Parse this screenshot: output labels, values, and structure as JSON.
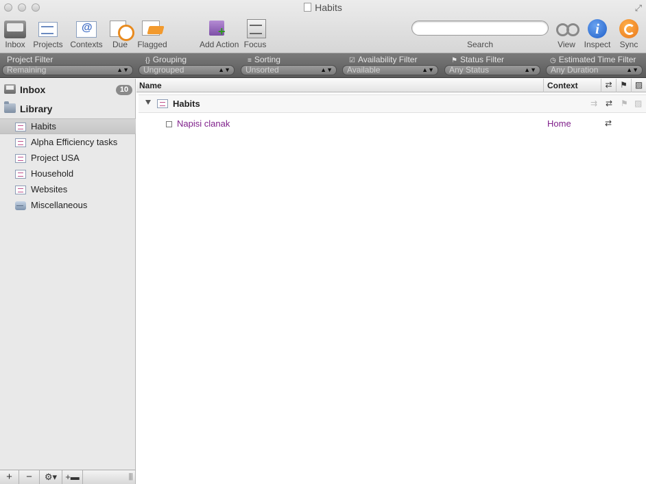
{
  "window": {
    "title": "Habits"
  },
  "toolbar": {
    "inbox": "Inbox",
    "projects": "Projects",
    "contexts": "Contexts",
    "due": "Due",
    "flagged": "Flagged",
    "add_action": "Add Action",
    "focus": "Focus",
    "search_label": "Search",
    "search_value": "",
    "view": "View",
    "inspect": "Inspect",
    "sync": "Sync"
  },
  "filters": {
    "project": {
      "title": "Project Filter",
      "value": "Remaining"
    },
    "grouping": {
      "title": "Grouping",
      "value": "Ungrouped"
    },
    "sorting": {
      "title": "Sorting",
      "value": "Unsorted"
    },
    "availability": {
      "title": "Availability Filter",
      "value": "Available"
    },
    "status": {
      "title": "Status Filter",
      "value": "Any Status"
    },
    "time": {
      "title": "Estimated Time Filter",
      "value": "Any Duration"
    }
  },
  "sidebar": {
    "inbox": {
      "label": "Inbox",
      "count": "10"
    },
    "library": {
      "label": "Library"
    },
    "items": [
      {
        "label": "Habits",
        "icon": "project-icon"
      },
      {
        "label": "Alpha Efficiency tasks",
        "icon": "project-icon"
      },
      {
        "label": "Project USA",
        "icon": "project-icon"
      },
      {
        "label": "Household",
        "icon": "project-icon"
      },
      {
        "label": "Websites",
        "icon": "project-icon"
      },
      {
        "label": "Miscellaneous",
        "icon": "single-action-list-icon"
      }
    ],
    "selected_index": 0
  },
  "outline": {
    "columns": {
      "name": "Name",
      "context": "Context"
    },
    "group": {
      "label": "Habits"
    },
    "tasks": [
      {
        "name": "Napisi clanak",
        "context": "Home",
        "repeat": true
      }
    ]
  },
  "colors": {
    "task_text": "#7f1f8a",
    "filter_bar": "#6a6a6a",
    "sidebar_bg": "#e9e9e9"
  }
}
